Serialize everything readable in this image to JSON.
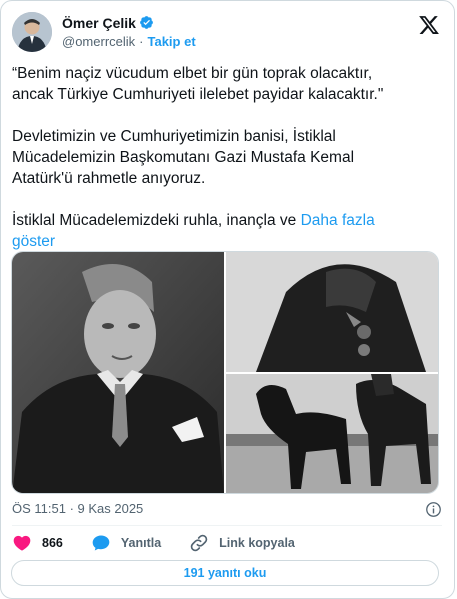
{
  "author": {
    "display_name": "Ömer Çelik",
    "handle": "@omerrcelik",
    "separator": "·",
    "follow_label": "Takip et"
  },
  "tweet": {
    "paragraphs": [
      "“Benim naçiz vücudum elbet bir gün toprak olacaktır,\nancak Türkiye Cumhuriyeti ilelebet payidar kalacaktır.\"",
      "Devletimizin ve Cumhuriyetimizin banisi, İstiklal\nMücadelemizin Başkomutanı Gazi Mustafa Kemal\nAtatürk'ü rahmetle anıyoruz."
    ],
    "truncated_text": "İstiklal Mücadelemizdeki ruhla, inançla ve ",
    "show_more_label": "Daha fazla\ngöster"
  },
  "meta": {
    "timestamp": "ÖS 11:51 · 9 Kas 2025"
  },
  "actions": {
    "like_count": "866",
    "reply_label": "Yanıtla",
    "copy_link_label": "Link kopyala"
  },
  "replies_button_label": "191 yanıtı oku",
  "colors": {
    "accent": "#1d9bf0",
    "like": "#f91880",
    "secondary_text": "#536471",
    "border": "#cfd9de"
  }
}
